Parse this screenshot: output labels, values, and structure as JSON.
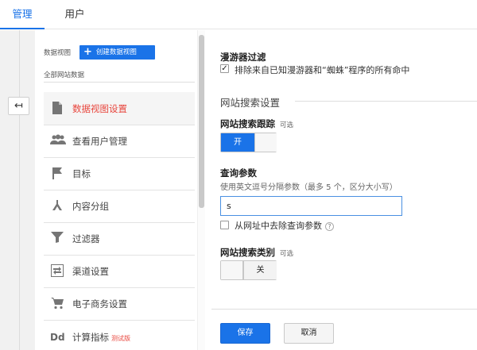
{
  "tabs": [
    {
      "label": "管理",
      "active": true
    },
    {
      "label": "用户",
      "active": false
    }
  ],
  "colors": {
    "accent": "#1a73e8",
    "active_nav": "#e8453c"
  },
  "column": {
    "label": "数据视图",
    "create_button": "创建数据视图",
    "create_icon": "plus-icon",
    "view_name": "全部网站数据",
    "back_icon": "arrow-back-icon"
  },
  "nav": [
    {
      "label": "数据视图设置",
      "icon": "document-icon",
      "active": true
    },
    {
      "label": "查看用户管理",
      "icon": "people-icon",
      "active": false
    },
    {
      "label": "目标",
      "icon": "flag-icon",
      "active": false
    },
    {
      "label": "内容分组",
      "icon": "content-grouping-icon",
      "active": false
    },
    {
      "label": "过滤器",
      "icon": "filter-icon",
      "active": false
    },
    {
      "label": "渠道设置",
      "icon": "channel-settings-icon",
      "active": false
    },
    {
      "label": "电子商务设置",
      "icon": "cart-icon",
      "active": false
    },
    {
      "label": "计算指标",
      "icon": "dd-icon",
      "active": false,
      "badge": "测试版"
    }
  ],
  "bot_filter": {
    "title": "漫游器过滤",
    "checkbox_label": "排除来自已知漫游器和“蜘蛛”程序的所有命中",
    "checked": true
  },
  "site_search": {
    "section_title": "网站搜索设置",
    "tracking_label": "网站搜索跟踪",
    "tracking_optional": "可选",
    "tracking_toggle": "开",
    "tracking_on": true,
    "query_param_label": "查询参数",
    "query_param_hint": "使用英文逗号分隔参数（最多 5 个，区分大小写）",
    "query_param_value": "s",
    "strip_label": "从网址中去除查询参数",
    "strip_checked": false,
    "category_label": "网站搜索类别",
    "category_optional": "可选",
    "category_toggle": "关",
    "category_on": false
  },
  "actions": {
    "save": "保存",
    "cancel": "取消"
  }
}
